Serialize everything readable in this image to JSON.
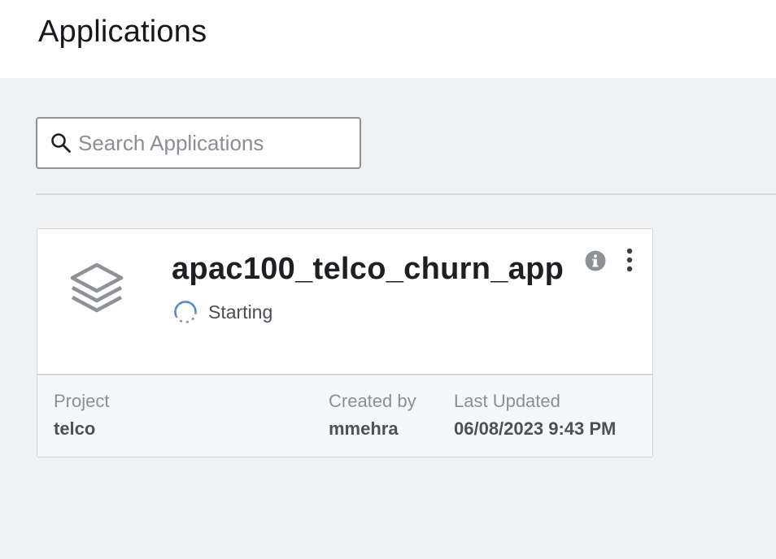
{
  "header": {
    "title": "Applications"
  },
  "search": {
    "placeholder": "Search Applications",
    "value": ""
  },
  "applications": [
    {
      "name": "apac100_telco_churn_app",
      "status": "Starting",
      "icon": "layers-icon",
      "project_label": "Project",
      "project": "telco",
      "created_by_label": "Created by",
      "created_by": "mmehra",
      "last_updated_label": "Last Updated",
      "last_updated": "06/08/2023 9:43 PM"
    }
  ],
  "colors": {
    "background": "#f0f1f3",
    "card": "#ffffff",
    "card_footer": "#f6f7f9",
    "spinner_accent": "#3b8fe6",
    "icon_gray": "#8e9297"
  }
}
